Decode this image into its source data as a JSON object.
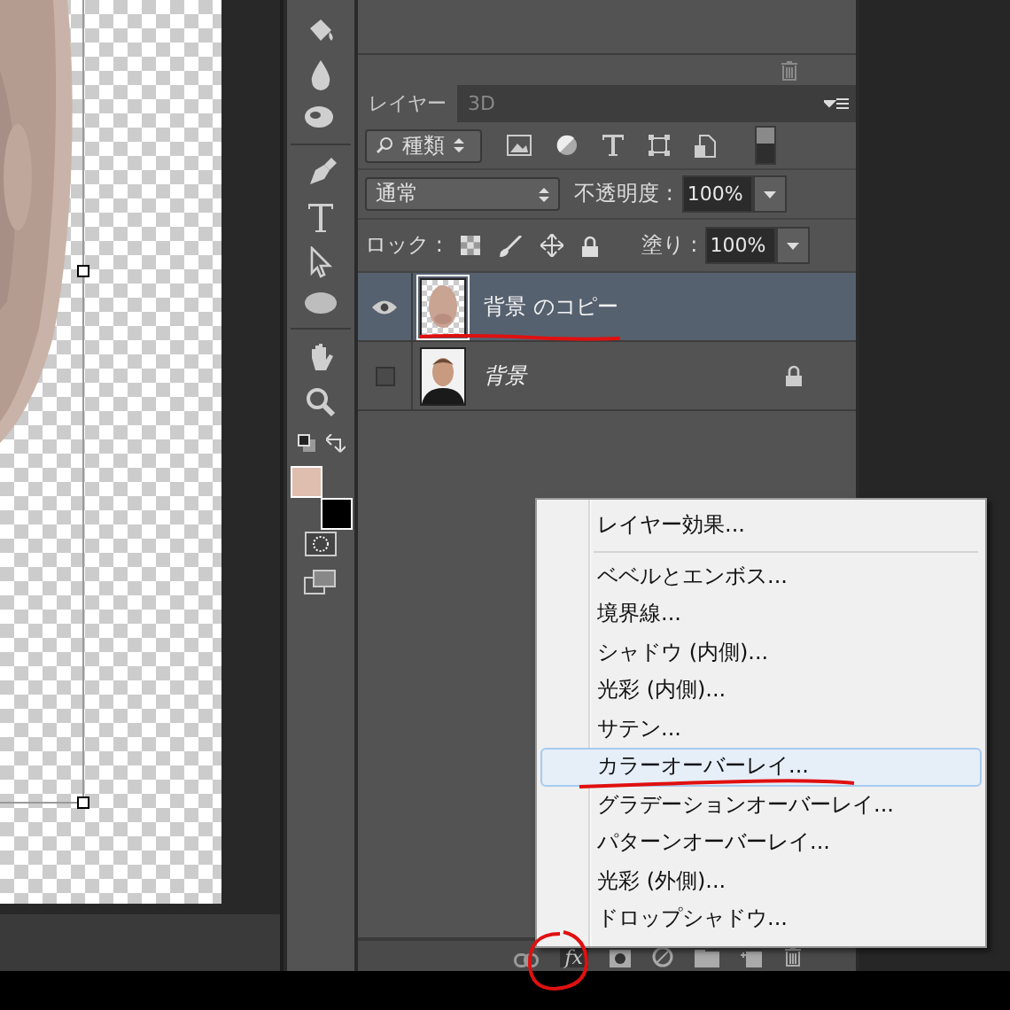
{
  "tools": {
    "foreground": {
      "color": "#dfbdaf"
    },
    "background": {
      "color": "#000000"
    }
  },
  "layers_panel": {
    "tabs": [
      {
        "label": "レイヤー",
        "selected": true
      },
      {
        "label": "3D",
        "selected": false
      }
    ],
    "filter": {
      "value": "種類"
    },
    "blend_mode": {
      "value": "通常"
    },
    "opacity": {
      "label": "不透明度 :",
      "value": "100%"
    },
    "lock": {
      "label": "ロック :"
    },
    "fill": {
      "label": "塗り :",
      "value": "100%"
    },
    "layers": [
      {
        "name": "背景 のコピー",
        "kind": "normal",
        "visible": true,
        "selected": true,
        "locked": false
      },
      {
        "name": "背景",
        "kind": "background",
        "visible": false,
        "selected": false,
        "locked": true
      }
    ],
    "fx_button": {
      "label": "fx"
    }
  },
  "context_menu": {
    "sections": [
      {
        "items": [
          {
            "label": "レイヤー効果...",
            "selected": false
          }
        ]
      },
      {
        "items": [
          {
            "label": "ベベルとエンボス...",
            "selected": false
          },
          {
            "label": "境界線...",
            "selected": false
          },
          {
            "label": "シャドウ (内側)...",
            "selected": false
          },
          {
            "label": "光彩 (内側)...",
            "selected": false
          },
          {
            "label": "サテン...",
            "selected": false
          },
          {
            "label": "カラーオーバーレイ...",
            "selected": true
          },
          {
            "label": "グラデーションオーバーレイ...",
            "selected": false
          },
          {
            "label": "パターンオーバーレイ...",
            "selected": false
          },
          {
            "label": "光彩 (外側)...",
            "selected": false
          },
          {
            "label": "ドロップシャドウ...",
            "selected": false
          }
        ]
      }
    ]
  }
}
